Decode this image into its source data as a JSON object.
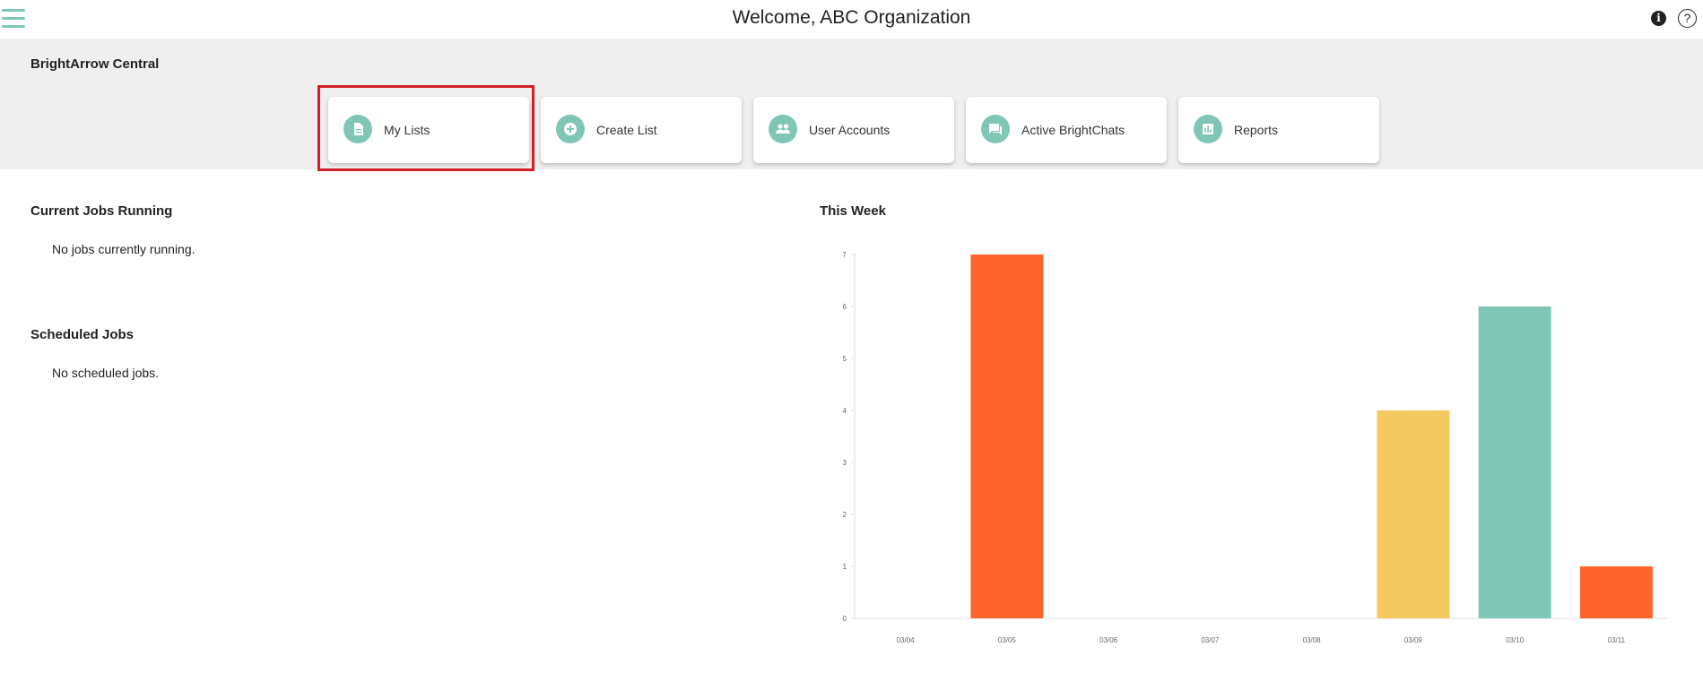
{
  "header": {
    "title": "Welcome, ABC Organization"
  },
  "central": {
    "title": "BrightArrow Central",
    "cards": [
      {
        "label": "My Lists",
        "icon": "document-icon"
      },
      {
        "label": "Create List",
        "icon": "plus-circle-icon"
      },
      {
        "label": "User Accounts",
        "icon": "users-icon"
      },
      {
        "label": "Active BrightChats",
        "icon": "chat-icon"
      },
      {
        "label": "Reports",
        "icon": "bar-chart-icon"
      }
    ]
  },
  "jobs": {
    "running_title": "Current Jobs Running",
    "running_text": "No jobs currently running.",
    "scheduled_title": "Scheduled Jobs",
    "scheduled_text": "No scheduled jobs."
  },
  "chart_title": "This Week",
  "colors": {
    "accent": "#7fc6b6",
    "orange": "#ff642d",
    "yellow": "#f4c962",
    "teal": "#7fc6b6",
    "highlight": "#d21f26"
  },
  "chart_data": {
    "type": "bar",
    "title": "This Week",
    "categories": [
      "03/04",
      "03/05",
      "03/06",
      "03/07",
      "03/08",
      "03/09",
      "03/10",
      "03/11"
    ],
    "values": [
      0,
      7,
      0,
      0,
      0,
      4,
      6,
      1
    ],
    "bar_colors": [
      "#ff642d",
      "#ff642d",
      "#ff642d",
      "#ff642d",
      "#ff642d",
      "#f4c962",
      "#7fc6b6",
      "#ff642d"
    ],
    "ylim": [
      0,
      7
    ],
    "yticks": [
      0,
      1,
      2,
      3,
      4,
      5,
      6,
      7
    ],
    "grid": false
  }
}
